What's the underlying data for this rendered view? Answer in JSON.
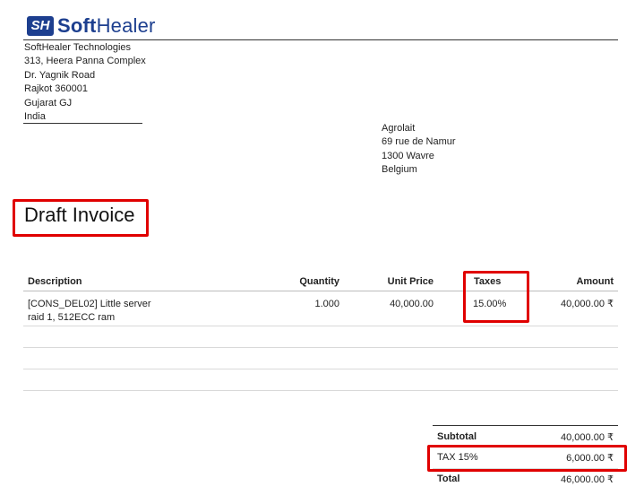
{
  "header": {
    "logo_mark": "SH",
    "logo_text_a": "Soft",
    "logo_text_b": "Healer"
  },
  "company": {
    "lines": [
      "SoftHealer Technologies",
      "313, Heera Panna Complex",
      "Dr. Yagnik Road",
      "Rajkot 360001",
      "Gujarat GJ",
      "India"
    ]
  },
  "customer": {
    "lines": [
      "Agrolait",
      "69 rue de Namur",
      "1300 Wavre",
      "Belgium"
    ]
  },
  "document": {
    "title": "Draft Invoice"
  },
  "table": {
    "headers": {
      "description": "Description",
      "quantity": "Quantity",
      "unit_price": "Unit Price",
      "taxes": "Taxes",
      "amount": "Amount"
    },
    "rows": [
      {
        "description_line1": "[CONS_DEL02] Little server",
        "description_line2": "raid 1, 512ECC ram",
        "quantity": "1.000",
        "unit_price": "40,000.00",
        "taxes": "15.00%",
        "amount": "40,000.00 ₹"
      }
    ]
  },
  "totals": {
    "subtotal_label": "Subtotal",
    "subtotal_value": "40,000.00 ₹",
    "tax_label": "TAX 15%",
    "tax_value": "6,000.00 ₹",
    "total_label": "Total",
    "total_value": "46,000.00 ₹"
  },
  "colors": {
    "brand": "#1d3f8f",
    "highlight": "#e00000"
  }
}
